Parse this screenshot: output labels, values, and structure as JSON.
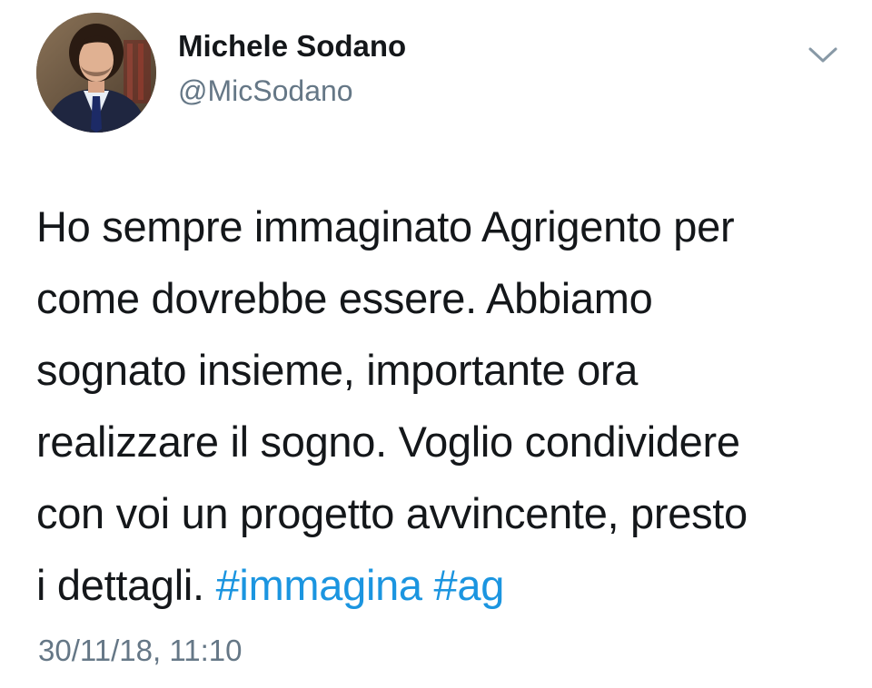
{
  "author": {
    "name": "Michele Sodano",
    "handle": "@MicSodano"
  },
  "tweet": {
    "lines": [
      "Ho sempre immaginato Agrigento per",
      "come dovrebbe essere. Abbiamo",
      "sognato insieme, importante ora",
      "realizzare il sogno. Voglio condividere",
      "con voi un progetto avvincente, presto"
    ],
    "last_line_text": "i dettagli.",
    "hashtags": [
      "#immagina",
      "#ag"
    ],
    "timestamp": "30/11/18, 11:10"
  },
  "icons": {
    "menu": "chevron-down-icon",
    "avatar": "profile-photo"
  },
  "colors": {
    "text": "#14171a",
    "secondary": "#657786",
    "link": "#1b95e0"
  }
}
